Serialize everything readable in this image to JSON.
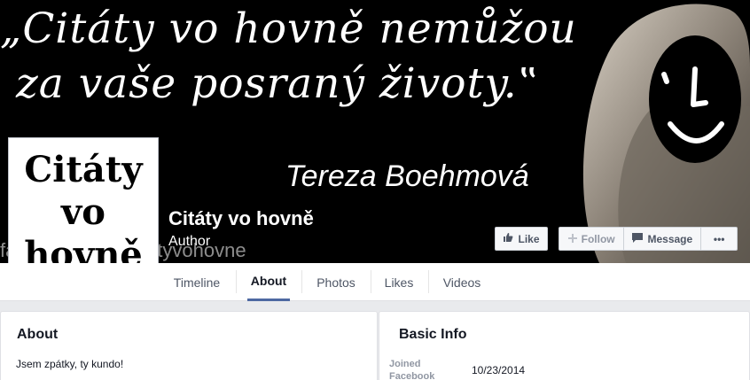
{
  "cover": {
    "quote_line1": "„Citáty vo hovně nemůžou",
    "quote_line2": "za vaše posraný životy.‟",
    "quote_author": "Tereza Boehmová",
    "watermark": "facebook.com/citatyvohovne"
  },
  "profile": {
    "picture_line1": "Citáty",
    "picture_line2": "vo",
    "picture_line3": "hovně",
    "name": "Citáty vo hovně",
    "category": "Author"
  },
  "actions": {
    "like_label": "Like",
    "follow_label": "Follow",
    "message_label": "Message",
    "more_label": "•••"
  },
  "nav": {
    "tabs": [
      {
        "label": "Timeline"
      },
      {
        "label": "About"
      },
      {
        "label": "Photos"
      },
      {
        "label": "Likes"
      },
      {
        "label": "Videos"
      }
    ],
    "active_tab": "About"
  },
  "about_card": {
    "title": "About",
    "text": "Jsem zpátky, ty kundo!"
  },
  "basic_info_card": {
    "title": "Basic Info",
    "fields": [
      {
        "label": "Joined Facebook",
        "value": "10/23/2014"
      }
    ]
  },
  "colors": {
    "cover_background": "#000000",
    "nav_active_underline": "#4e69a2",
    "page_background": "#e9eaed"
  }
}
